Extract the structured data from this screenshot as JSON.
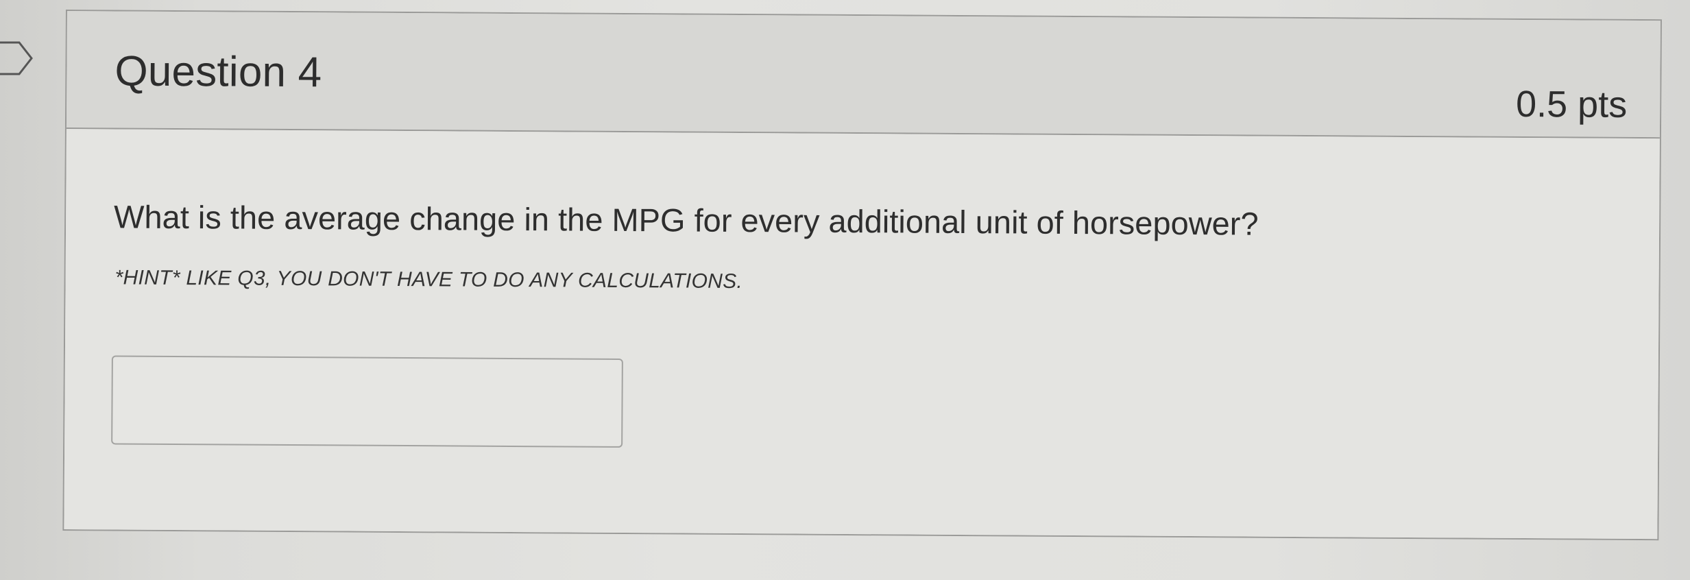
{
  "question": {
    "title": "Question 4",
    "points": "0.5 pts",
    "text": "What is the average change in the MPG for every additional unit of horsepower?",
    "hint": "*HINT* LIKE Q3, YOU DON'T HAVE TO DO ANY CALCULATIONS.",
    "answer_value": "",
    "flag_icon": "bookmark-flag-icon"
  },
  "colors": {
    "background": "#e3e3e0",
    "header_background": "#d7d7d4",
    "border": "#9a9a98",
    "text": "#2d2d2d"
  }
}
